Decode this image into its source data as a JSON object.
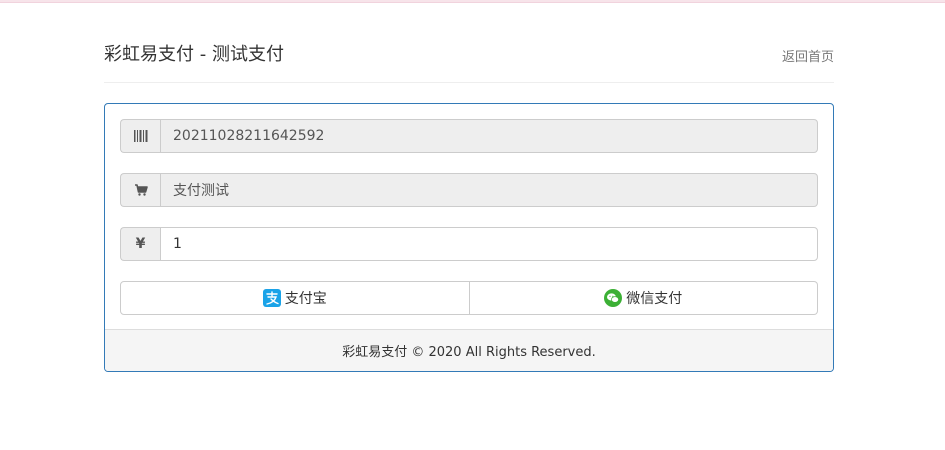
{
  "header": {
    "title": "彩虹易支付 - 测试支付",
    "home_link": "返回首页"
  },
  "form": {
    "order_no": {
      "icon": "barcode-icon",
      "value": "20211028211642592"
    },
    "product_name": {
      "icon": "shopping-cart-icon",
      "value": "支付测试"
    },
    "amount": {
      "icon": "yen-icon",
      "icon_glyph": "¥",
      "value": "1"
    }
  },
  "payment_buttons": {
    "alipay": {
      "label": "支付宝",
      "icon": "alipay-icon",
      "color": "#1aa3e8"
    },
    "wechat": {
      "label": "微信支付",
      "icon": "wechat-icon",
      "color": "#3cb035"
    }
  },
  "footer": {
    "text": "彩虹易支付 © 2020 All Rights Reserved."
  },
  "colors": {
    "panel_border": "#337ab7",
    "top_strip": "#f7e4ea"
  }
}
